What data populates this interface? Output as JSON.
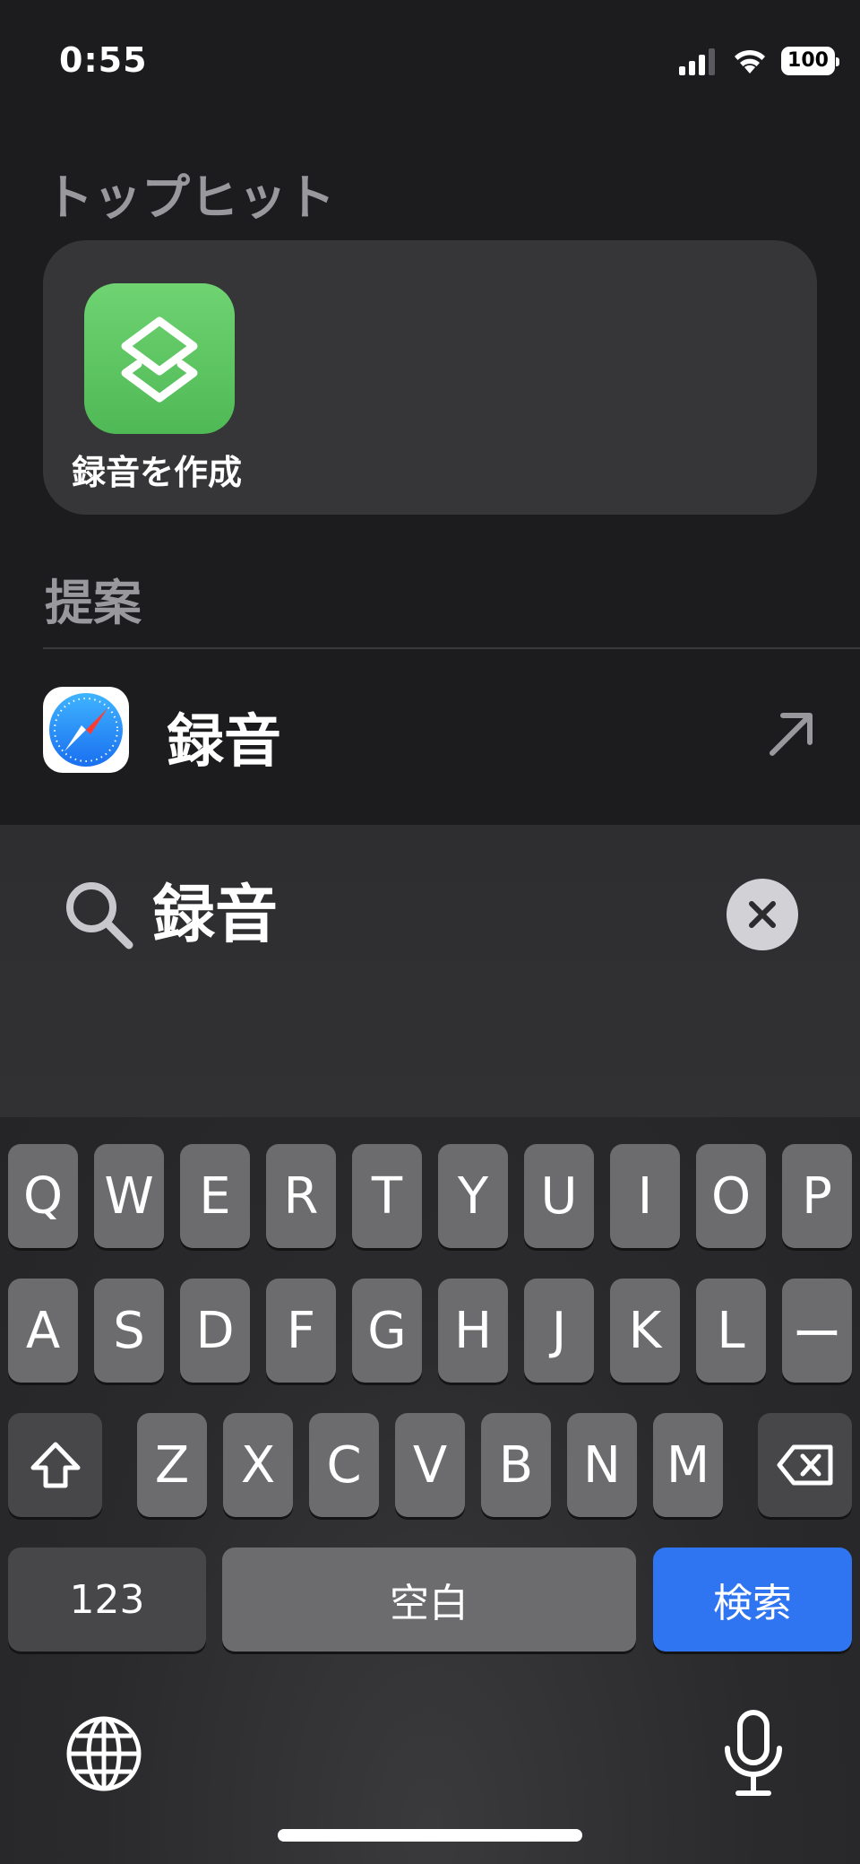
{
  "status_bar": {
    "time": "0:55",
    "battery": "100"
  },
  "top_hit": {
    "section_title": "トップヒット",
    "shortcut_label": "録音を作成",
    "shortcut_icon": "shortcuts-icon",
    "tile_color": "#5cc65f"
  },
  "suggestions": {
    "section_title": "提案",
    "items": [
      {
        "label": "録音",
        "icon": "safari-icon"
      }
    ]
  },
  "search": {
    "value": "録音",
    "placeholder": ""
  },
  "keyboard": {
    "row1": [
      "Q",
      "W",
      "E",
      "R",
      "T",
      "Y",
      "U",
      "I",
      "O",
      "P"
    ],
    "row2": [
      "A",
      "S",
      "D",
      "F",
      "G",
      "H",
      "J",
      "K",
      "L",
      "ー"
    ],
    "row3": [
      "Z",
      "X",
      "C",
      "V",
      "B",
      "N",
      "M"
    ],
    "numbers_label": "123",
    "space_label": "空白",
    "search_label": "検索",
    "search_key_color": "#2f74f0"
  }
}
